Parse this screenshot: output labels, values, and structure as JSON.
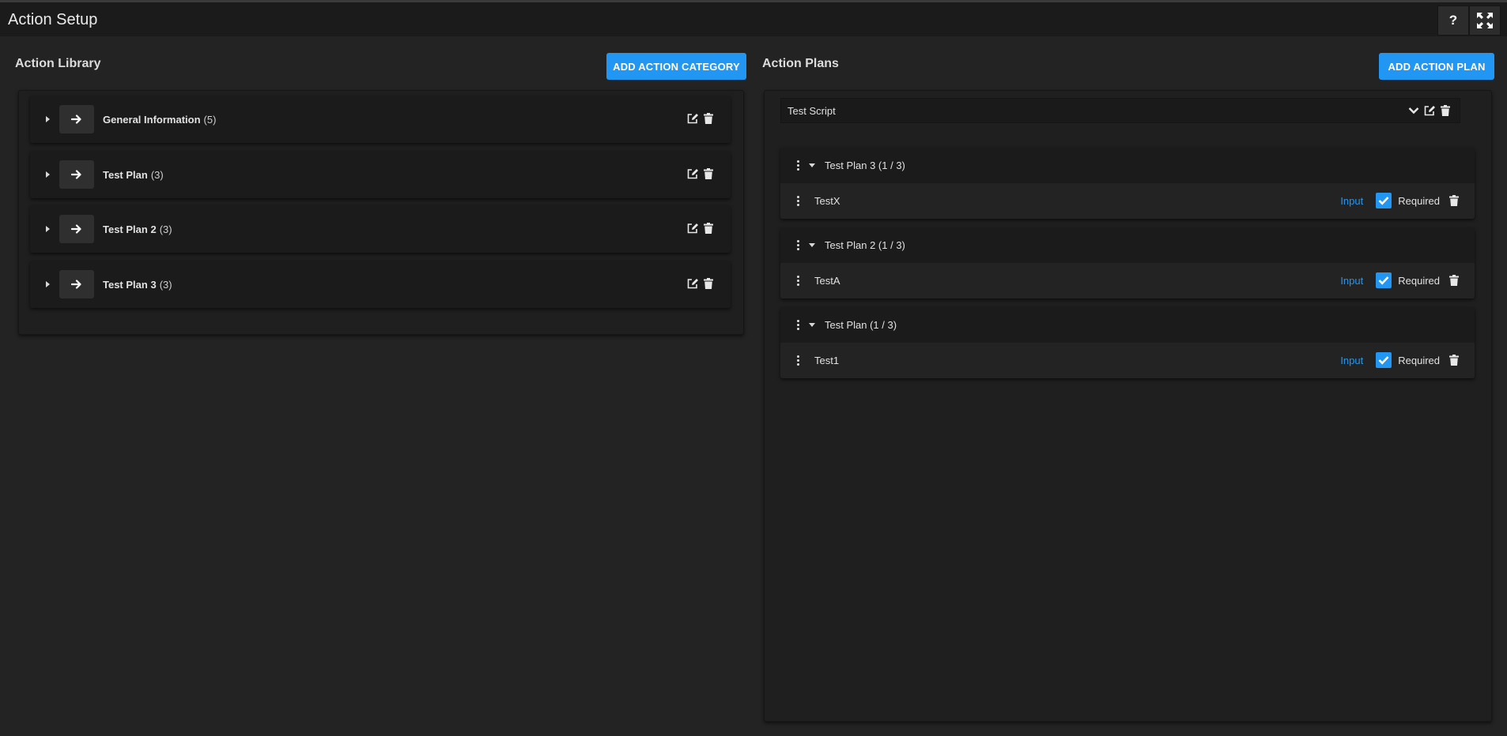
{
  "header": {
    "title": "Action Setup",
    "help_label": "?",
    "help_icon": "question-icon",
    "fullscreen_icon": "expand-icon"
  },
  "library": {
    "title": "Action Library",
    "add_button": "ADD ACTION CATEGORY",
    "categories": [
      {
        "name": "General Information",
        "count": "(5)"
      },
      {
        "name": "Test Plan",
        "count": "(3)"
      },
      {
        "name": "Test Plan 2",
        "count": "(3)"
      },
      {
        "name": "Test Plan 3",
        "count": "(3)"
      }
    ]
  },
  "plans": {
    "title": "Action Plans",
    "add_button": "ADD ACTION PLAN",
    "selected_plan": "Test Script",
    "groups": [
      {
        "name": "Test Plan 3 (1 / 3)",
        "row": {
          "name": "TestX",
          "type": "Input",
          "required_label": "Required",
          "required": true
        }
      },
      {
        "name": "Test Plan 2 (1 / 3)",
        "row": {
          "name": "TestA",
          "type": "Input",
          "required_label": "Required",
          "required": true
        }
      },
      {
        "name": "Test Plan (1 / 3)",
        "row": {
          "name": "Test1",
          "type": "Input",
          "required_label": "Required",
          "required": true
        }
      }
    ]
  },
  "colors": {
    "accent": "#2196f3",
    "background": "#232323",
    "header": "#1b1b1b"
  }
}
